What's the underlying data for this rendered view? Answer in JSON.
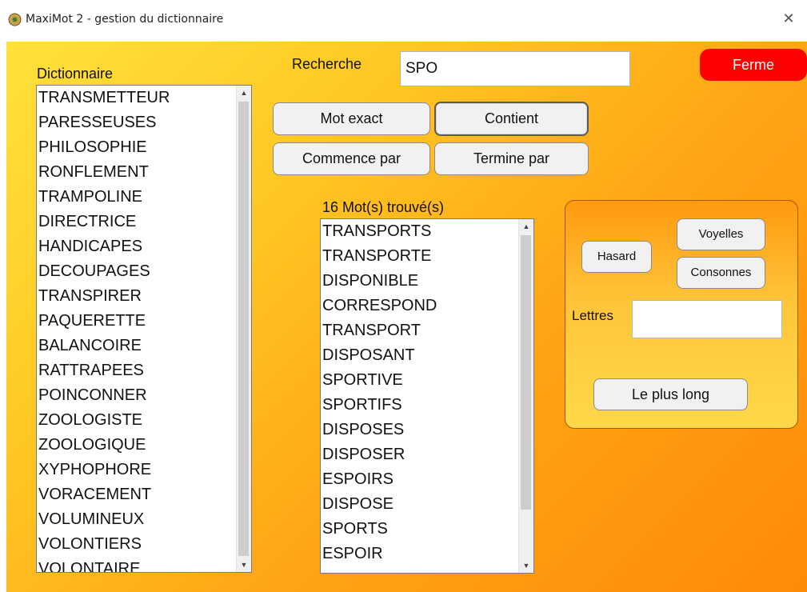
{
  "window": {
    "title": "MaxiMot 2 - gestion du dictionnaire",
    "close_glyph": "✕"
  },
  "dictionary": {
    "label": "Dictionnaire",
    "items": [
      "TRANSMETTEUR",
      "PARESSEUSES",
      "PHILOSOPHIE",
      "RONFLEMENT",
      "TRAMPOLINE",
      "DIRECTRICE",
      "HANDICAPES",
      "DECOUPAGES",
      "TRANSPIRER",
      "PAQUERETTE",
      "BALANCOIRE",
      "RATTRAPEES",
      "POINCONNER",
      "ZOOLOGISTE",
      "ZOOLOGIQUE",
      "XYPHOPHORE",
      "VORACEMENT",
      "VOLUMINEUX",
      "VOLONTIERS",
      "VOLONTAIRE"
    ]
  },
  "search": {
    "label": "Recherche",
    "value": "SPO"
  },
  "buttons": {
    "close": "Ferme",
    "exact": "Mot exact",
    "contains": "Contient",
    "starts": "Commence par",
    "ends": "Termine par"
  },
  "results": {
    "label": "16 Mot(s) trouvé(s)",
    "items": [
      "TRANSPORTS",
      "TRANSPORTE",
      "DISPONIBLE",
      "CORRESPOND",
      "TRANSPORT",
      "DISPOSANT",
      "SPORTIVE",
      "SPORTIFS",
      "DISPOSES",
      "DISPOSER",
      "ESPOIRS",
      "DISPOSE",
      "SPORTS",
      "ESPOIR"
    ]
  },
  "letters_panel": {
    "random": "Hasard",
    "vowels": "Voyelles",
    "consonants": "Consonnes",
    "letters_label": "Lettres",
    "letters_value": "",
    "longest": "Le plus long"
  },
  "colors": {
    "background_top": "#ffe23a",
    "background_bottom": "#ff8a08",
    "close_button": "#ff0000"
  }
}
